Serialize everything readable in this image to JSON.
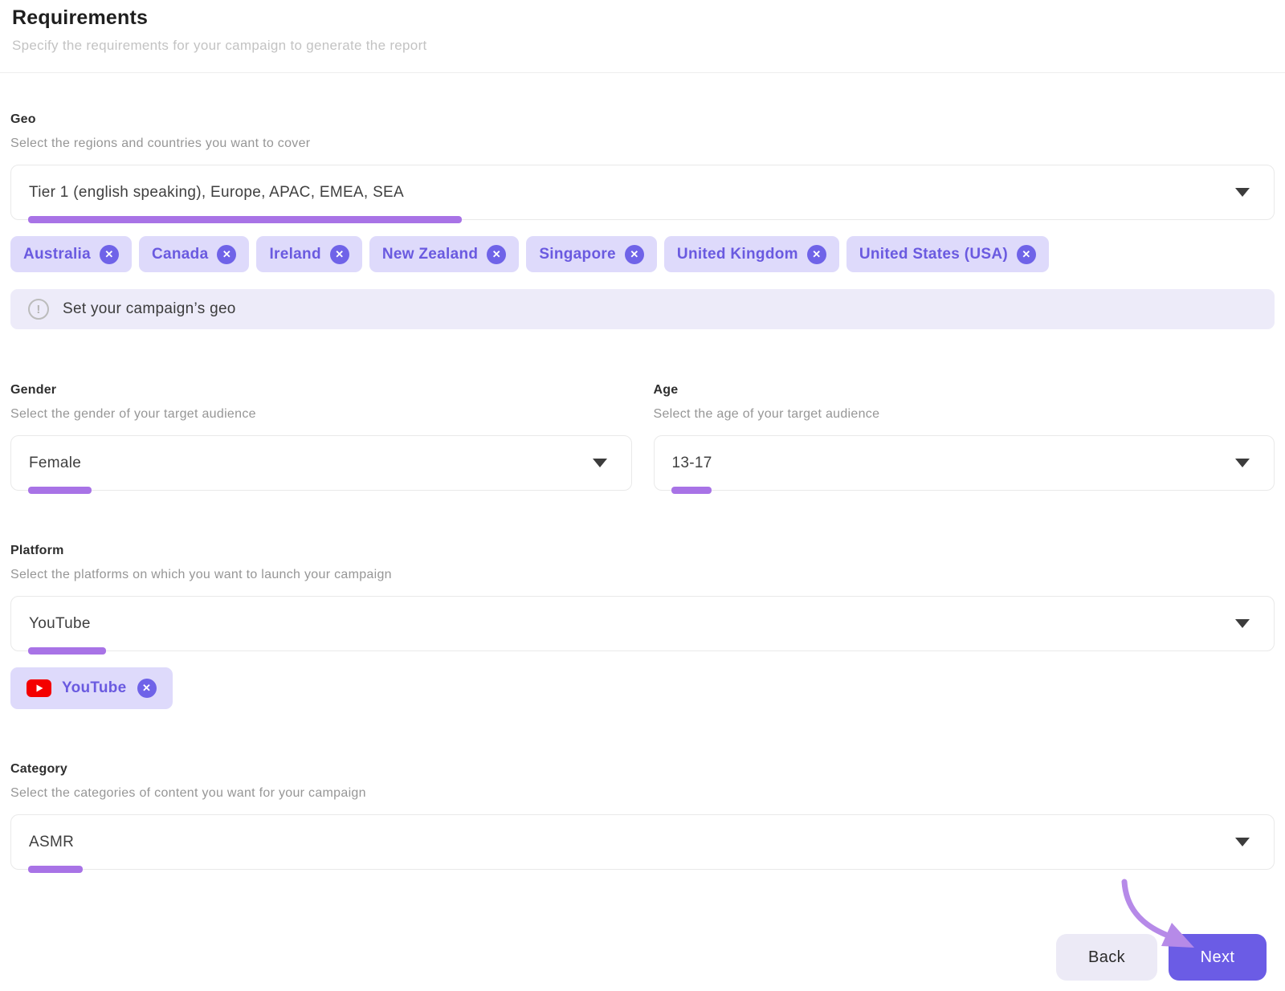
{
  "header": {
    "title": "Requirements",
    "subtitle": "Specify the requirements for your campaign to generate the report"
  },
  "geo": {
    "label": "Geo",
    "description": "Select the regions and countries you want to cover",
    "value": "Tier 1 (english speaking), Europe, APAC, EMEA, SEA",
    "tags": [
      "Australia",
      "Canada",
      "Ireland",
      "New Zealand",
      "Singapore",
      "United Kingdom",
      "United States (USA)"
    ],
    "notice": "Set your campaign’s geo"
  },
  "gender": {
    "label": "Gender",
    "description": "Select the gender of your target audience",
    "value": "Female"
  },
  "age": {
    "label": "Age",
    "description": "Select the age of your target audience",
    "value": "13-17"
  },
  "platform": {
    "label": "Platform",
    "description": "Select the platforms on which you want to launch your campaign",
    "value": "YouTube",
    "tags": [
      "YouTube"
    ]
  },
  "category": {
    "label": "Category",
    "description": "Select the categories of content you want for your campaign",
    "value": "ASMR"
  },
  "footer": {
    "back_label": "Back",
    "next_label": "Next"
  },
  "icons": {
    "remove": "✕",
    "info": "!"
  },
  "colors": {
    "accent_purple": "#6b5ce5",
    "tag_background": "#dedafb",
    "tag_text": "#6a5ae0",
    "notice_background": "#edebf9",
    "annotation_purple": "#a873e6",
    "arrow_purple": "#b68ae8",
    "youtube_red": "#f40000"
  }
}
